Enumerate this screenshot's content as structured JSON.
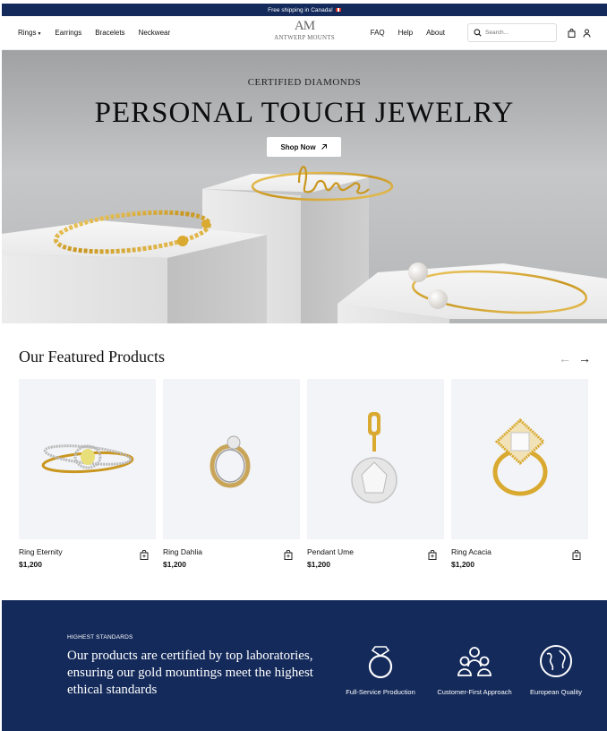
{
  "announcement": {
    "text": "Free shipping in Canada!",
    "flag_icon": "canada-flag-icon"
  },
  "header": {
    "nav_left": [
      {
        "label": "Rings",
        "has_dropdown": true
      },
      {
        "label": "Earrings"
      },
      {
        "label": "Bracelets"
      },
      {
        "label": "Neckwear"
      }
    ],
    "logo": {
      "mark": "AM",
      "text": "ANTWERP MOUNTS"
    },
    "nav_right": [
      {
        "label": "FAQ"
      },
      {
        "label": "Help"
      },
      {
        "label": "About"
      }
    ],
    "search": {
      "placeholder": "Search...",
      "value": ""
    },
    "icons": [
      "search-icon",
      "bag-icon",
      "user-icon"
    ]
  },
  "hero": {
    "subtitle": "CERTIFIED DIAMONDS",
    "title": "PERSONAL TOUCH JEWELRY",
    "cta_label": "Shop Now",
    "cta_icon": "arrow-up-right-icon"
  },
  "featured": {
    "title": "Our Featured Products",
    "products": [
      {
        "name": "Ring Eternity",
        "price": "$1,200"
      },
      {
        "name": "Ring Dahlia",
        "price": "$1,200"
      },
      {
        "name": "Pendant Ume",
        "price": "$1,200"
      },
      {
        "name": "Ring Acacia",
        "price": "$1,200"
      }
    ]
  },
  "standards": {
    "label": "HIGHEST STANDARDS",
    "text": "Our products are certified by top laboratories, ensuring our gold mountings meet the highest ethical standards",
    "features": [
      {
        "label": "Full-Service Production",
        "icon": "ring-icon"
      },
      {
        "label": "Customer-First Approach",
        "icon": "people-icon"
      },
      {
        "label": "European Quality",
        "icon": "globe-icon"
      }
    ]
  },
  "colors": {
    "navy": "#142a5b",
    "card_bg": "#f3f4f7",
    "gold": "#d4a72c"
  }
}
